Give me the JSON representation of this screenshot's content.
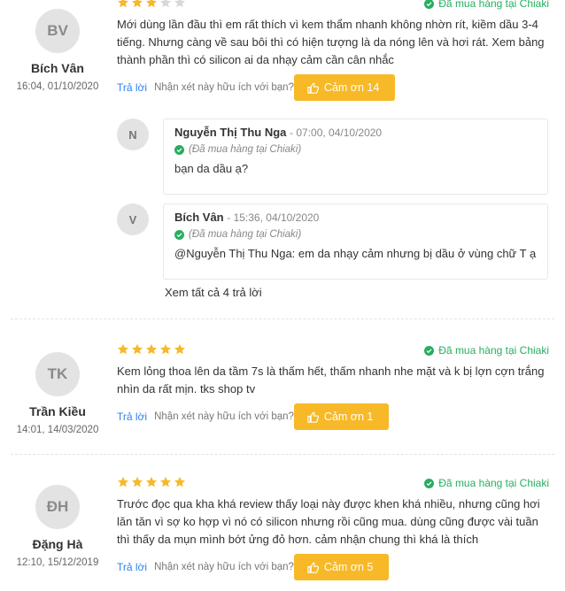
{
  "colors": {
    "star_gold": "#f7b928",
    "star_grey": "#d8d8d8",
    "verified_green": "#27ae60",
    "link_blue": "#2f80ed",
    "thanks_bg": "#f7b928"
  },
  "reviews": [
    {
      "initials": "BV",
      "name": "Bích Vân",
      "date": "16:04, 01/10/2020",
      "rating": 3,
      "verified": "Đã mua hàng tại Chiaki",
      "text": "Mới dùng lần đầu thì em rất thích vì kem thẩm nhanh không nhờn rít, kiềm dầu 3-4 tiếng. Nhưng càng về sau bôi thì có hiện tượng là da nóng lên và hơi rát. Xem bảng thành phần thì có silicon ai da nhạy cảm cần cân nhắc",
      "reply_label": "Trả lời",
      "helpful_label": "Nhận xét này hữu ích với bạn?",
      "thanks_label": "Cảm ơn 14",
      "replies": [
        {
          "initial": "N",
          "name": "Nguyễn Thị Thu Nga",
          "date": "- 07:00, 04/10/2020",
          "bought": "(Đã mua hàng tại Chiaki)",
          "text": "bạn da dầu ạ?"
        },
        {
          "initial": "V",
          "name": "Bích Vân",
          "date": "- 15:36, 04/10/2020",
          "bought": "(Đã mua hàng tại Chiaki)",
          "text": "@Nguyễn Thị Thu Nga: em da nhạy cảm nhưng bị dầu ở vùng chữ T ạ"
        }
      ],
      "see_all": "Xem tất cả 4 trả lời"
    },
    {
      "initials": "TK",
      "name": "Trần Kiều",
      "date": "14:01, 14/03/2020",
      "rating": 5,
      "verified": "Đã mua hàng tại Chiaki",
      "text": "Kem lỏng thoa lên da tầm 7s là thấm hết, thấm nhanh nhe mặt và k bị lợn cợn trắng nhìn da rất mịn. tks shop tv",
      "reply_label": "Trả lời",
      "helpful_label": "Nhận xét này hữu ích với bạn?",
      "thanks_label": "Cảm ơn 1"
    },
    {
      "initials": "ĐH",
      "name": "Đặng Hà",
      "date": "12:10, 15/12/2019",
      "rating": 5,
      "verified": "Đã mua hàng tại Chiaki",
      "text": "Trước đọc qua kha khá review thấy loại này được khen khá nhiều, nhưng cũng hơi lăn tăn vì sợ ko hợp vì nó có silicon nhưng rồi cũng mua. dùng cũng được vài tuần thì thấy da mụn mình bớt ửng đỏ hơn. cảm nhận chung thì khá là thích",
      "reply_label": "Trả lời",
      "helpful_label": "Nhận xét này hữu ích với bạn?",
      "thanks_label": "Cảm ơn 5"
    }
  ]
}
